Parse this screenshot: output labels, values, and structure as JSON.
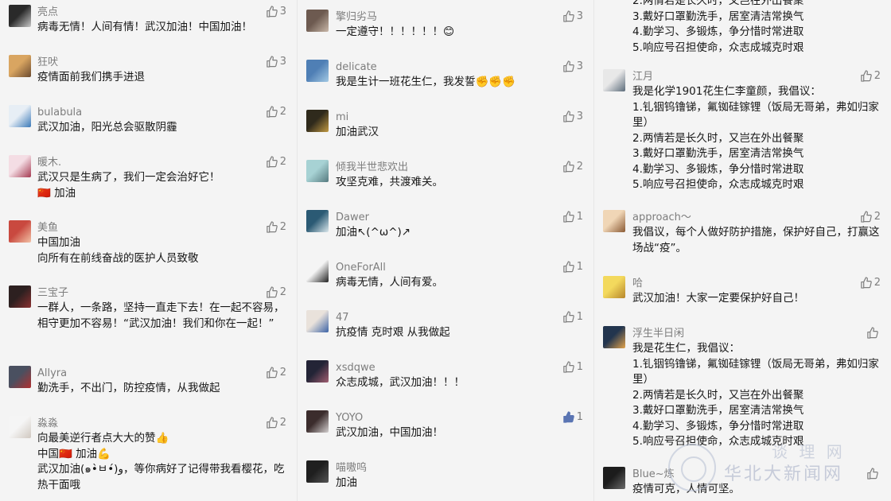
{
  "columns": [
    {
      "comments": [
        {
          "name": "亮点",
          "text": "病毒无情！人间有情！武汉加油！中国加油！",
          "likes": "3",
          "avatar_colors": [
            "#2a2a2a",
            "#c8c8c8"
          ]
        },
        {
          "name": "狂吠",
          "text": "疫情面前我们携手进退",
          "likes": "3",
          "avatar_colors": [
            "#d9a561",
            "#6b4a2f"
          ]
        },
        {
          "name": "bulabula",
          "text": "武汉加油，阳光总会驱散阴霾",
          "likes": "2",
          "avatar_colors": [
            "#e7eef5",
            "#3b79b8"
          ]
        },
        {
          "name": "暖木.",
          "text": "武汉只是生病了，我们一定会治好它！\n🇨🇳 加油",
          "likes": "2",
          "avatar_colors": [
            "#f4dde4",
            "#a53a52"
          ]
        },
        {
          "name": "美鱼",
          "text": "中国加油\n向所有在前线奋战的医护人员致敬",
          "likes": "2",
          "avatar_colors": [
            "#c9493f",
            "#f2c2a6"
          ]
        },
        {
          "name": "三宝子",
          "text": "一群人，一条路，坚持一直走下去！在一起不容易，相守更加不容易！“武汉加油！我们和你在一起！”",
          "likes": "2",
          "avatar_colors": [
            "#2d2020",
            "#8a3030"
          ]
        },
        {
          "name": "Allyra",
          "text": "勤洗手，不出门，防控疫情，从我做起",
          "likes": "2",
          "avatar_colors": [
            "#4a5060",
            "#b03030"
          ]
        },
        {
          "name": "淼淼",
          "text": "向最美逆行者点大大的赞👍\n中国🇨🇳 加油💪\n武汉加油(๑•̀ㅂ•́)و，等你病好了记得带我看樱花，吃热干面哦",
          "likes": "2",
          "avatar_colors": [
            "#f5f5f5",
            "#d0c8c0"
          ]
        }
      ]
    },
    {
      "comments": [
        {
          "name": "擎归劣马",
          "text": "一定遵守！！！！！！😊",
          "likes": "3",
          "avatar_colors": [
            "#6d5a50",
            "#c9b7a8"
          ]
        },
        {
          "name": "delicate",
          "text": "我是生计一班花生仁，我发誓✊✊✊",
          "likes": "3",
          "avatar_colors": [
            "#4f7fb5",
            "#a3c9e4"
          ]
        },
        {
          "name": "mi",
          "text": "加油武汉",
          "likes": "3",
          "avatar_colors": [
            "#2f2a1c",
            "#c29a42"
          ]
        },
        {
          "name": "倾我半世悲欢出",
          "text": "攻坚克难，共渡难关。",
          "likes": "2",
          "avatar_colors": [
            "#a7d2d4",
            "#567a7f"
          ]
        },
        {
          "name": "Dawer",
          "text": "加油↖(^ω^)↗",
          "likes": "1",
          "avatar_colors": [
            "#2b5a74",
            "#dbe7ec"
          ]
        },
        {
          "name": "OneForAll",
          "text": "病毒无情，人间有爱。",
          "likes": "1",
          "avatar_colors": [
            "#f4f4f4",
            "#222222"
          ]
        },
        {
          "name": "47",
          "text": "抗疫情 克时艰 从我做起",
          "likes": "1",
          "avatar_colors": [
            "#e9e2db",
            "#3c63a6"
          ]
        },
        {
          "name": "xsdqwe",
          "text": "众志成城，武汉加油！！！",
          "likes": "1",
          "avatar_colors": [
            "#232436",
            "#a15f72"
          ]
        },
        {
          "name": "YOYO",
          "text": "武汉加油，中国加油！",
          "likes": "1",
          "liked": true,
          "avatar_colors": [
            "#3b2c2c",
            "#d3cfcf"
          ]
        },
        {
          "name": "喵嗷呜",
          "text": "加油",
          "likes": "",
          "avatar_colors": [
            "#1f1f1f",
            "#555555"
          ]
        }
      ]
    },
    {
      "top_fragment": "2.两情若是长久时，又岂在外出餐聚\n3.戴好口罩勤洗手，居室清洁常换气\n4.勤学习、多锻炼，争分惜时常进取\n5.响应号召担使命，众志成城克时艰",
      "comments": [
        {
          "name": "江月",
          "text": "我是化学1901花生仁李童颜，我倡议：\n1.钆铟钨镥锑，氟铷硅镓锂（饭局无哥弟，弗如归家里）\n2.两情若是长久时，又岂在外出餐聚\n3.戴好口罩勤洗手，居室清洁常换气\n4.勤学习、多锻炼，争分惜时常进取\n5.响应号召担使命，众志成城克时艰",
          "likes": "2",
          "avatar_colors": [
            "#e8e8e8",
            "#5b6b7a"
          ]
        },
        {
          "name": "approach～",
          "text": "我倡议，每个人做好防护措施，保护好自己，打赢这场战“疫”。",
          "likes": "2",
          "avatar_colors": [
            "#f0d6b6",
            "#8a5a34"
          ]
        },
        {
          "name": "哈",
          "text": "武汉加油！大家一定要保护好自己！",
          "likes": "2",
          "avatar_colors": [
            "#f3d95d",
            "#b7862c"
          ]
        },
        {
          "name": "浮生半日闲",
          "text": "我是花生仁，我倡议：\n1.钆铟钨镥锑，氟铷硅镓锂（饭局无哥弟，弗如归家里）\n2.两情若是长久时，又岂在外出餐聚\n3.戴好口罩勤洗手，居室清洁常换气\n4.勤学习、多锻炼，争分惜时常进取\n5.响应号召担使命，众志成城克时艰",
          "likes": "",
          "avatar_colors": [
            "#22354e",
            "#e3a34c"
          ]
        },
        {
          "name": "Blue~炼",
          "text": "疫情可克，人情可坚。",
          "likes": "",
          "avatar_colors": [
            "#1c1c1c",
            "#6a6a6a"
          ]
        }
      ]
    }
  ],
  "watermark": {
    "text": "华北大新闻网",
    "text_small": "谈 理 网"
  },
  "colors": {
    "accent_like": "#5a75b3",
    "name": "#7d7d7d",
    "text": "#161616",
    "background": "#f4f4f4"
  }
}
